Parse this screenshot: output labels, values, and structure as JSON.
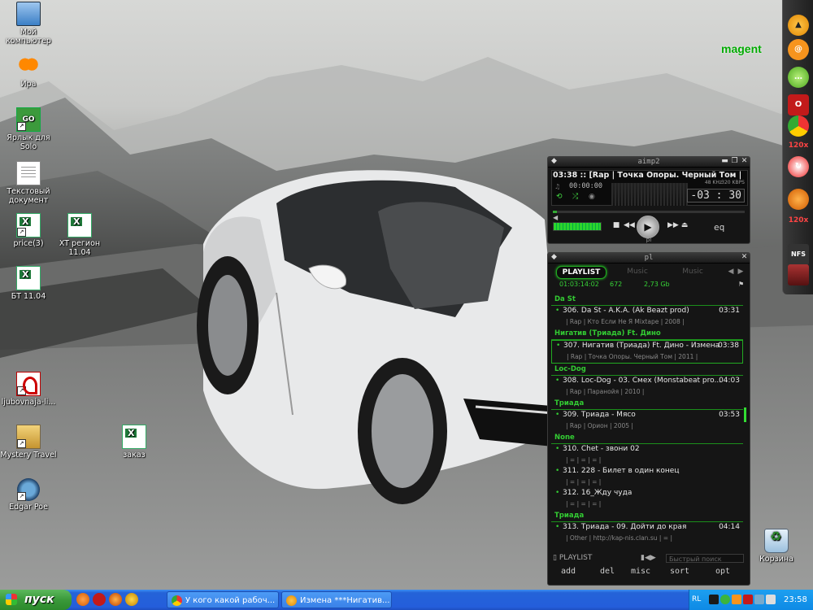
{
  "desktop": {
    "icons": [
      {
        "label": "Мой компьютер"
      },
      {
        "label": "Ира"
      },
      {
        "label": "Ярлык для Solo"
      },
      {
        "label": "Текстовый документ"
      },
      {
        "label": "price(3)"
      },
      {
        "label": "XT регион 11.04"
      },
      {
        "label": "БТ 11.04"
      },
      {
        "label": "ljubovnaja-li..."
      },
      {
        "label": "Mystery Travel"
      },
      {
        "label": "заказ"
      },
      {
        "label": "Edgar Poe"
      },
      {
        "label": "Корзина"
      }
    ],
    "solo_badge": "GO",
    "gadget_label": "magent",
    "dock_labels": {
      "badge1": "120x",
      "badge2": "120x",
      "nfs": "NFS"
    }
  },
  "player": {
    "title": "aimp2",
    "track_display": "03:38 :: [Rap | Точка Опоры. Черный Том | 2011 ]",
    "current_time": "00:00:00",
    "time_remaining": "-03 : 30",
    "bitrate": "320 KBPS",
    "samplerate": "48 KHz",
    "seek_progress": 0.02,
    "volume_level": 0.9,
    "eq_label": "eq",
    "footer_label": "pl"
  },
  "playlist": {
    "tabs": [
      {
        "label": "PLAYLIST",
        "active": true
      },
      {
        "label": "Music",
        "active": false
      },
      {
        "label": "Music",
        "active": false
      }
    ],
    "stats": {
      "duration": "01:03:14:02",
      "count": "672",
      "size": "2,73 Gb"
    },
    "groups": [
      {
        "name": "Da St",
        "tracks": [
          {
            "title": "306. Da St - A.K.A. (Ak Beazt prod)",
            "duration": "03:31",
            "info": "| Rap | Кто Если Не Я Mixtape | 2008 |",
            "selected": false
          }
        ]
      },
      {
        "name": "Нигатив (Триада) Ft. Дино",
        "tracks": [
          {
            "title": "307. Нигатив (Триада) Ft. Дино - Измена",
            "duration": "03:38",
            "info": "| Rap | Точка Опоры. Черный Том | 2011 |",
            "selected": true
          }
        ]
      },
      {
        "name": "Loc-Dog",
        "tracks": [
          {
            "title": "308. Loc-Dog - 03. Смех (Monstabeat pro...",
            "duration": "04:03",
            "info": "| Rap | Паранойя | 2010 |",
            "selected": false
          }
        ]
      },
      {
        "name": "Триада",
        "tracks": [
          {
            "title": "309. Триада - Мясо",
            "duration": "03:53",
            "info": "| Rap | Орион | 2005 |",
            "selected": false
          }
        ]
      },
      {
        "name": "None",
        "tracks": [
          {
            "title": "310. Chet - звони 02",
            "duration": "",
            "info": "| = | = | = |",
            "selected": false
          },
          {
            "title": "311. 228 - Билет в один конец",
            "duration": "",
            "info": "| = | = | = |",
            "selected": false
          },
          {
            "title": "312. 16_Жду чуда",
            "duration": "",
            "info": "| = | = | = |",
            "selected": false
          }
        ]
      },
      {
        "name": "Триада",
        "tracks": [
          {
            "title": "313. Триада - 09. Дойти до края",
            "duration": "04:14",
            "info": "| Other | http://kap-nis.clan.su | = |",
            "selected": false
          }
        ]
      }
    ],
    "footer_title": "PLAYLIST",
    "search_placeholder": "Быстрый поиск",
    "buttons": [
      "add",
      "del",
      "misc",
      "sort",
      "opt"
    ],
    "footer_label": "pl"
  },
  "taskbar": {
    "start_label": "пуск",
    "windows": [
      {
        "label": "У кого какой рабоч..."
      },
      {
        "label": "Измена ***Нигатив..."
      }
    ],
    "lang": "RL",
    "clock": "23:58"
  },
  "colors": {
    "accent_green": "#33cc33",
    "taskbar_blue": "#245edb",
    "start_green": "#3a993a"
  }
}
